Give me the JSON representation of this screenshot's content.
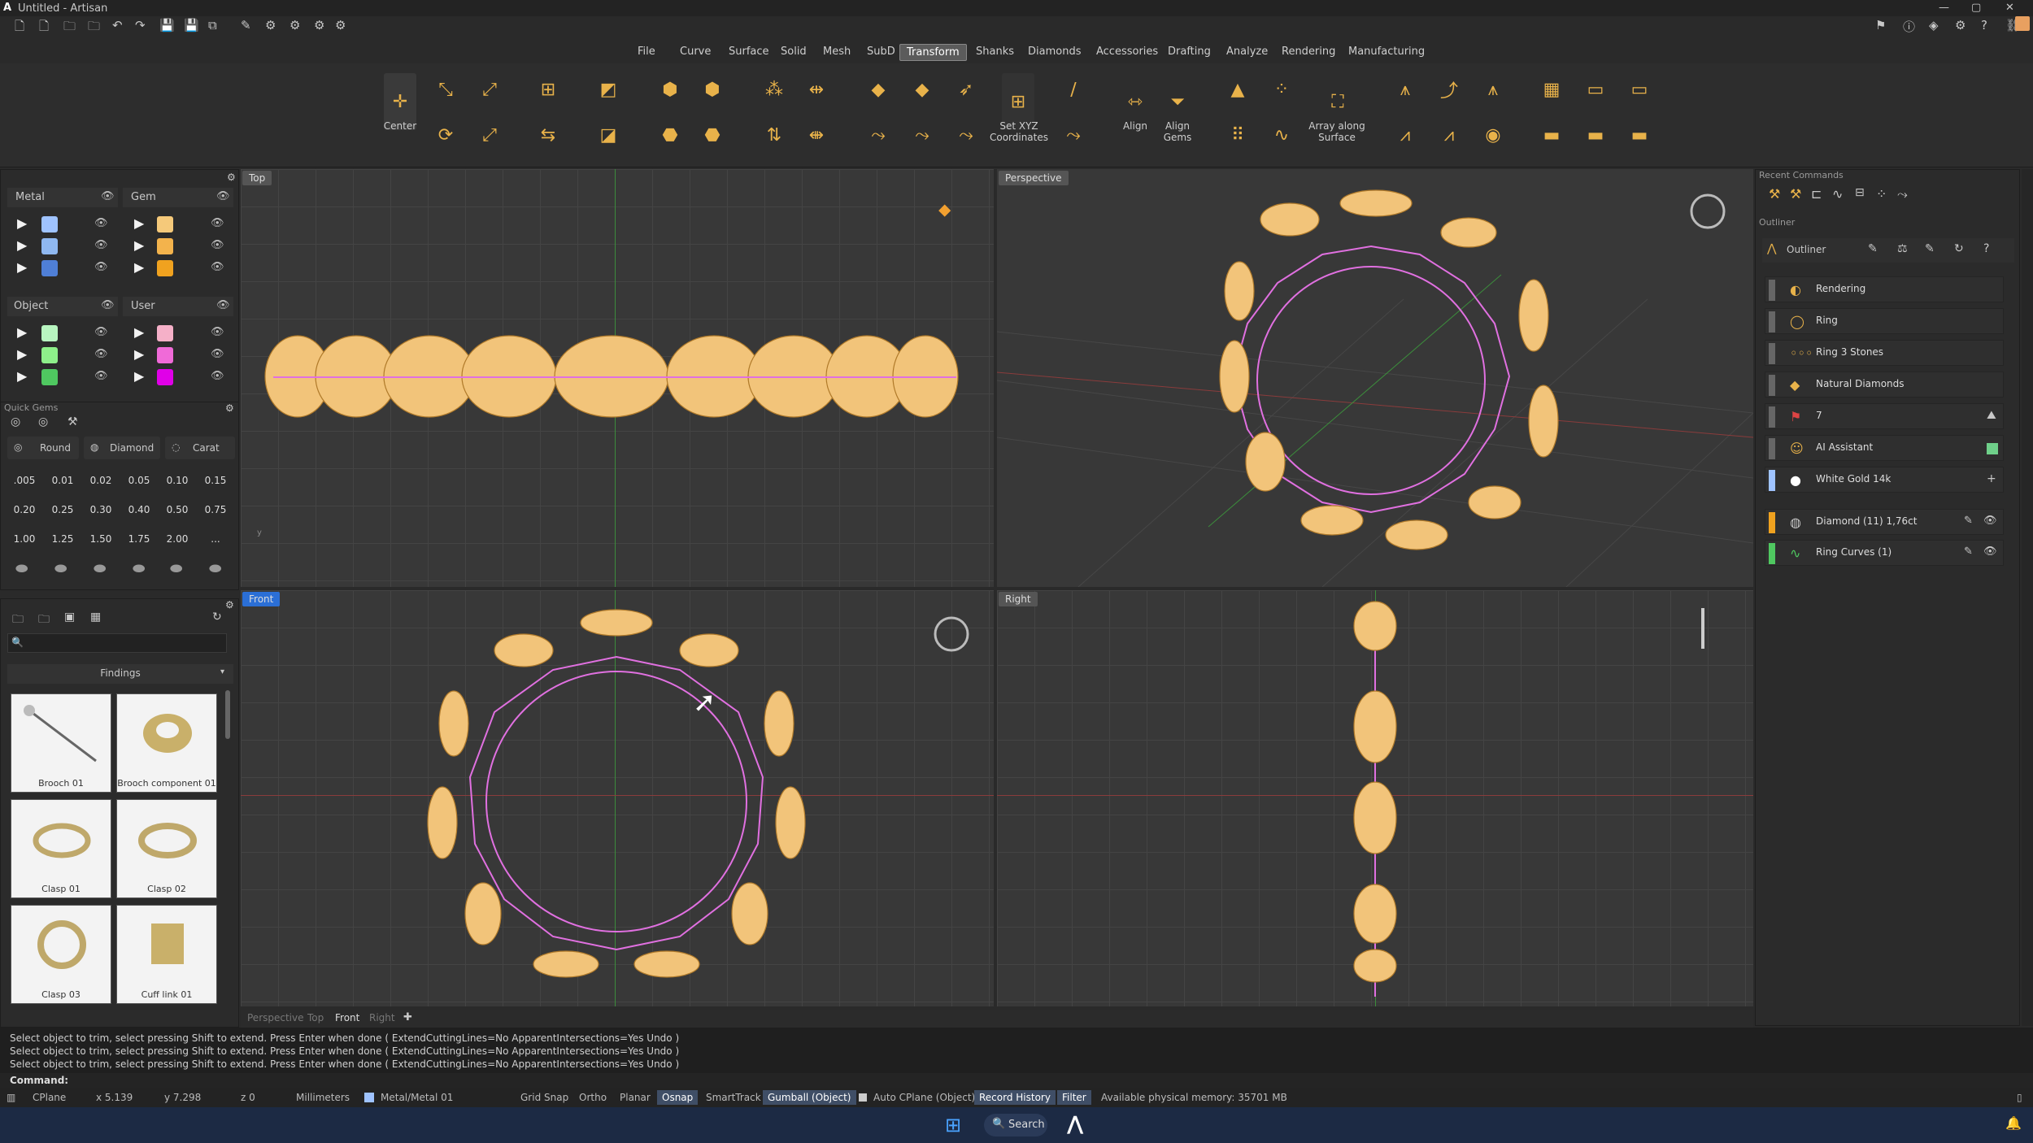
{
  "window": {
    "title": "Untitled - Artisan"
  },
  "menu": [
    "File",
    "Curve",
    "Surface",
    "Solid",
    "Mesh",
    "SubD",
    "Transform",
    "Shanks",
    "Diamonds",
    "Accessories",
    "Drafting",
    "Analyze",
    "Rendering",
    "Manufacturing"
  ],
  "menu_active": "Transform",
  "ribbon": {
    "center_label": "Center",
    "set_xyz_label": "Set XYZ Coordinates",
    "align_label": "Align",
    "align_gems_label": "Align Gems",
    "array_label": "Array along Surface"
  },
  "layers": {
    "metal_label": "Metal",
    "gem_label": "Gem",
    "object_label": "Object",
    "user_label": "User",
    "metal_colors": [
      "#9fc3ff",
      "#8fb8f0",
      "#4f7fd6"
    ],
    "gem_colors": [
      "#f5c97a",
      "#f3b34c",
      "#f0a21f"
    ],
    "object_colors": [
      "#b8f5c0",
      "#8ef08a",
      "#4fc860"
    ],
    "user_colors": [
      "#f5b0c8",
      "#f06ad8",
      "#e000e8"
    ]
  },
  "quick_gems": {
    "title": "Quick Gems",
    "shape": "Round",
    "material": "Diamond",
    "unit": "Carat",
    "sizes": [
      ".005",
      "0.01",
      "0.02",
      "0.05",
      "0.10",
      "0.15",
      "0.20",
      "0.25",
      "0.30",
      "0.40",
      "0.50",
      "0.75",
      "1.00",
      "1.25",
      "1.50",
      "1.75",
      "2.00",
      "..."
    ]
  },
  "library": {
    "category": "Findings",
    "items": [
      "Brooch 01",
      "Brooch component 01",
      "Clasp 01",
      "Clasp 02",
      "Clasp 03",
      "Cuff link 01"
    ]
  },
  "viewports": {
    "top": "Top",
    "perspective": "Perspective",
    "front": "Front",
    "right": "Right"
  },
  "viewport_tabs": [
    "Perspective",
    "Top",
    "Front",
    "Right"
  ],
  "recent_commands_title": "Recent Commands",
  "outliner": {
    "panel_title": "Outliner",
    "header": "Outliner",
    "rows": [
      "Rendering",
      "Ring",
      "Ring 3 Stones",
      "Natural Diamonds",
      "7",
      "AI Assistant",
      "White Gold 14k"
    ],
    "objects": [
      "Diamond (11) 1,76ct",
      "Ring Curves (1)"
    ]
  },
  "history": [
    "Select object to trim, select pressing Shift to extend. Press Enter when done ( ExtendCuttingLines=No  ApparentIntersections=Yes  Undo )",
    "Select object to trim, select pressing Shift to extend. Press Enter when done ( ExtendCuttingLines=No  ApparentIntersections=Yes  Undo )",
    "Select object to trim, select pressing Shift to extend. Press Enter when done ( ExtendCuttingLines=No  ApparentIntersections=Yes  Undo )"
  ],
  "command_label": "Command:",
  "status": {
    "cplane": "CPlane",
    "x": "x 5.139",
    "y": "y 7.298",
    "z": "z 0",
    "units": "Millimeters",
    "layer": "Metal/Metal 01",
    "grid_snap": "Grid Snap",
    "ortho": "Ortho",
    "planar": "Planar",
    "osnap": "Osnap",
    "smarttrack": "SmartTrack",
    "gumball": "Gumball (Object)",
    "auto_cplane": "Auto CPlane (Object)",
    "record_history": "Record History",
    "filter": "Filter",
    "memory": "Available physical memory: 35701 MB"
  },
  "taskbar": {
    "search": "Search"
  },
  "colors": {
    "gem": "#f2c47a",
    "curve": "#e070e0",
    "accent_tab": "#2b6fd6"
  }
}
